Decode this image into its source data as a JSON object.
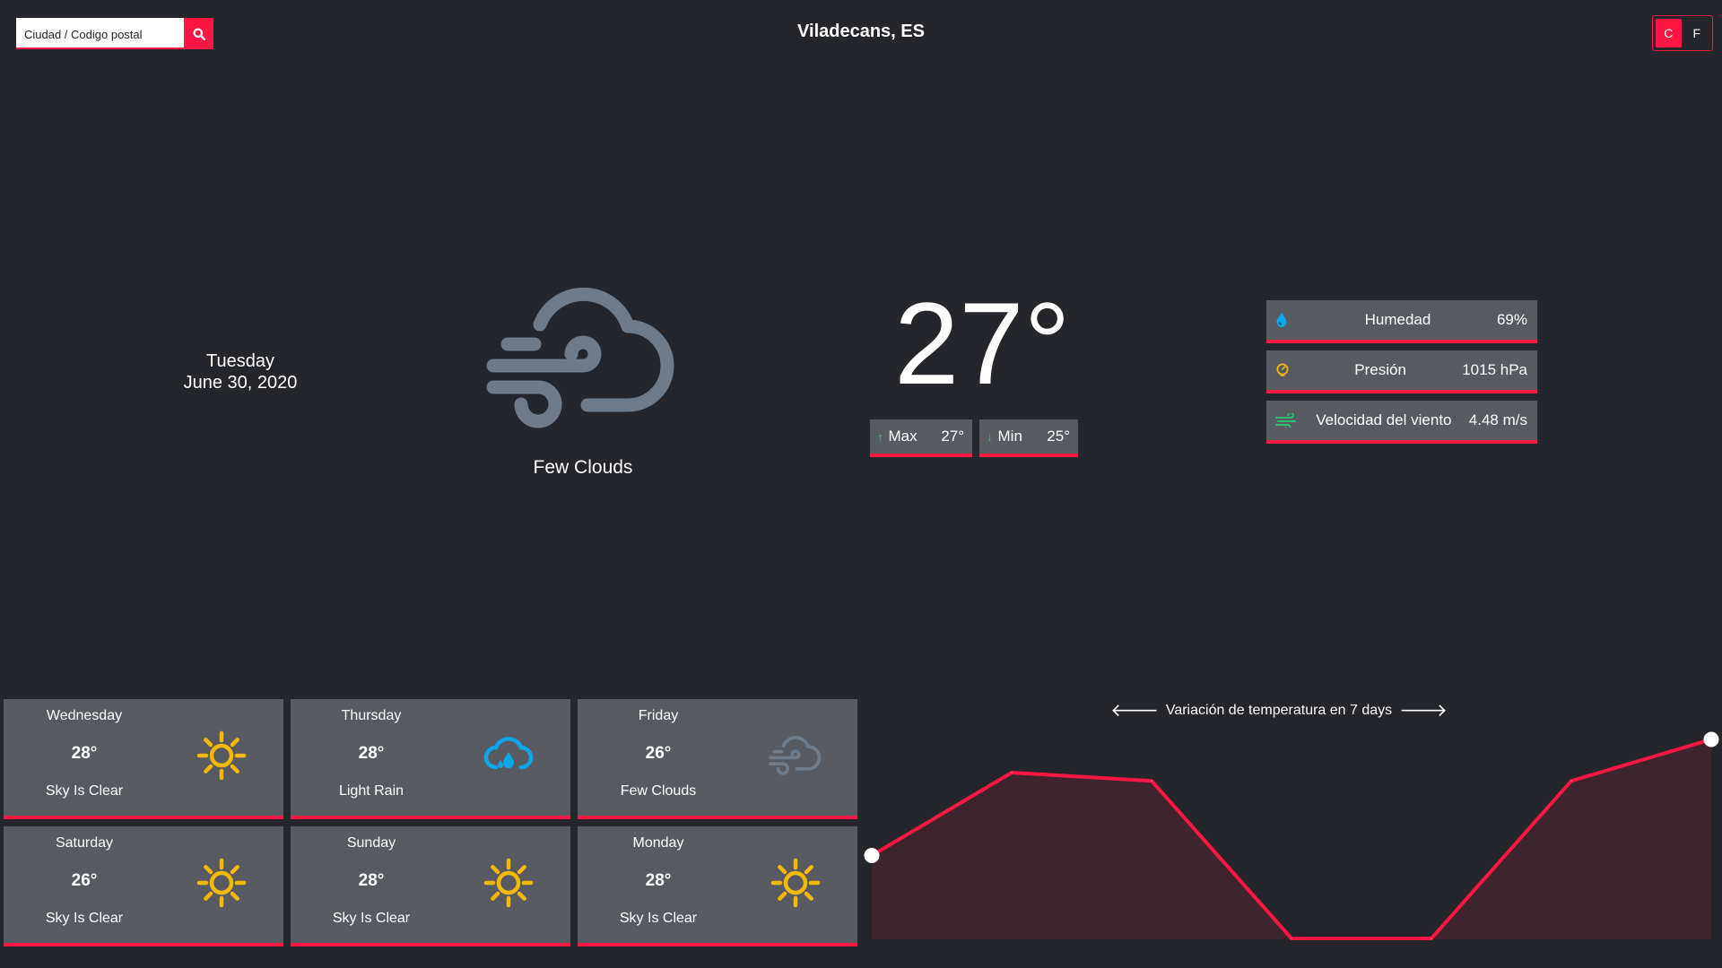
{
  "search": {
    "placeholder": "Ciudad / Codigo postal",
    "value": ""
  },
  "location": "Viladecans, ES",
  "units": {
    "celsius": "C",
    "fahrenheit": "F",
    "selected": "C"
  },
  "current": {
    "day": "Tuesday",
    "date": "June 30, 2020",
    "temp": "27°",
    "description": "Few Clouds",
    "icon": "wind-cloud-icon",
    "max_label": "Max",
    "max_value": "27°",
    "min_label": "Min",
    "min_value": "25°"
  },
  "stats": [
    {
      "label": "Humedad",
      "value": "69%",
      "icon": "droplet-icon"
    },
    {
      "label": "Presión",
      "value": "1015 hPa",
      "icon": "gauge-icon"
    },
    {
      "label": "Velocidad del viento",
      "value": "4.48 m/s",
      "icon": "wind-icon"
    }
  ],
  "forecast": [
    {
      "day": "Wednesday",
      "temp": "28°",
      "desc": "Sky Is Clear",
      "icon": "sun-icon"
    },
    {
      "day": "Thursday",
      "temp": "28°",
      "desc": "Light Rain",
      "icon": "rain-cloud-icon"
    },
    {
      "day": "Friday",
      "temp": "26°",
      "desc": "Few Clouds",
      "icon": "wind-cloud-icon"
    },
    {
      "day": "Saturday",
      "temp": "26°",
      "desc": "Sky Is Clear",
      "icon": "sun-icon"
    },
    {
      "day": "Sunday",
      "temp": "28°",
      "desc": "Sky Is Clear",
      "icon": "sun-icon"
    },
    {
      "day": "Monday",
      "temp": "28°",
      "desc": "Sky Is Clear",
      "icon": "sun-icon"
    }
  ],
  "chart_label": "Variación de temperatura en 7 days",
  "colors": {
    "background": "#24262b",
    "panel": "#575b61",
    "accent": "#ff1744",
    "sun": "#f5b800",
    "rain": "#0ea5e9",
    "cloud": "#6e7b8b"
  },
  "chart_data": {
    "type": "area",
    "x": [
      1,
      2,
      3,
      4,
      5,
      6,
      7
    ],
    "values": [
      27.0,
      28.0,
      27.9,
      26.0,
      26.0,
      27.9,
      28.4
    ],
    "ylim": [
      26.0,
      28.4
    ],
    "title": "Variación de temperatura en 7 days",
    "xlabel": "",
    "ylabel": "",
    "grid": false
  }
}
